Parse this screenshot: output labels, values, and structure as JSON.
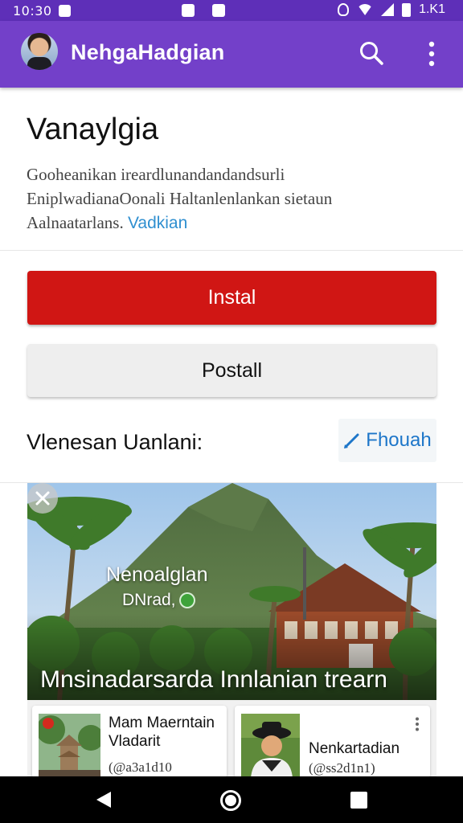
{
  "status_bar": {
    "time": "10:30",
    "battery": "1.K1"
  },
  "app_bar": {
    "title": "NehgaHadgian",
    "icons": [
      "avatar",
      "search-icon",
      "more-vert-icon"
    ]
  },
  "header": {
    "title": "Vanaylgia",
    "description_line1": "Gooheanikan ireardlunandandandsurli",
    "description_line2": "EniplwadianaOonali Haltanlenlankan sietaun",
    "description_line3": "Aalnaatarlans.",
    "description_link": "Vadkian"
  },
  "actions": {
    "install_label": "Instal",
    "postall_label": "Postall"
  },
  "section": {
    "title": "Vlenesan Uanlani:",
    "follow_label": "Fhouah",
    "follow_icon": "pencil-icon"
  },
  "feature": {
    "name": "Nenoalglan",
    "subtitle": "DNrad,",
    "caption": "Mnsinadarsarda Innlanian trearn",
    "close_icon": "close-icon"
  },
  "cards": [
    {
      "title": "Mam Maerntain Vladarit",
      "meta": "(@a3a1d10"
    },
    {
      "title": "Nenkartadian",
      "meta": "(@ss2d1n1)"
    }
  ],
  "colors": {
    "status_bar": "#5e2fb8",
    "app_bar": "#7340c9",
    "install": "#d01614",
    "link": "#2f8fd0",
    "follow": "#1d76c9"
  }
}
